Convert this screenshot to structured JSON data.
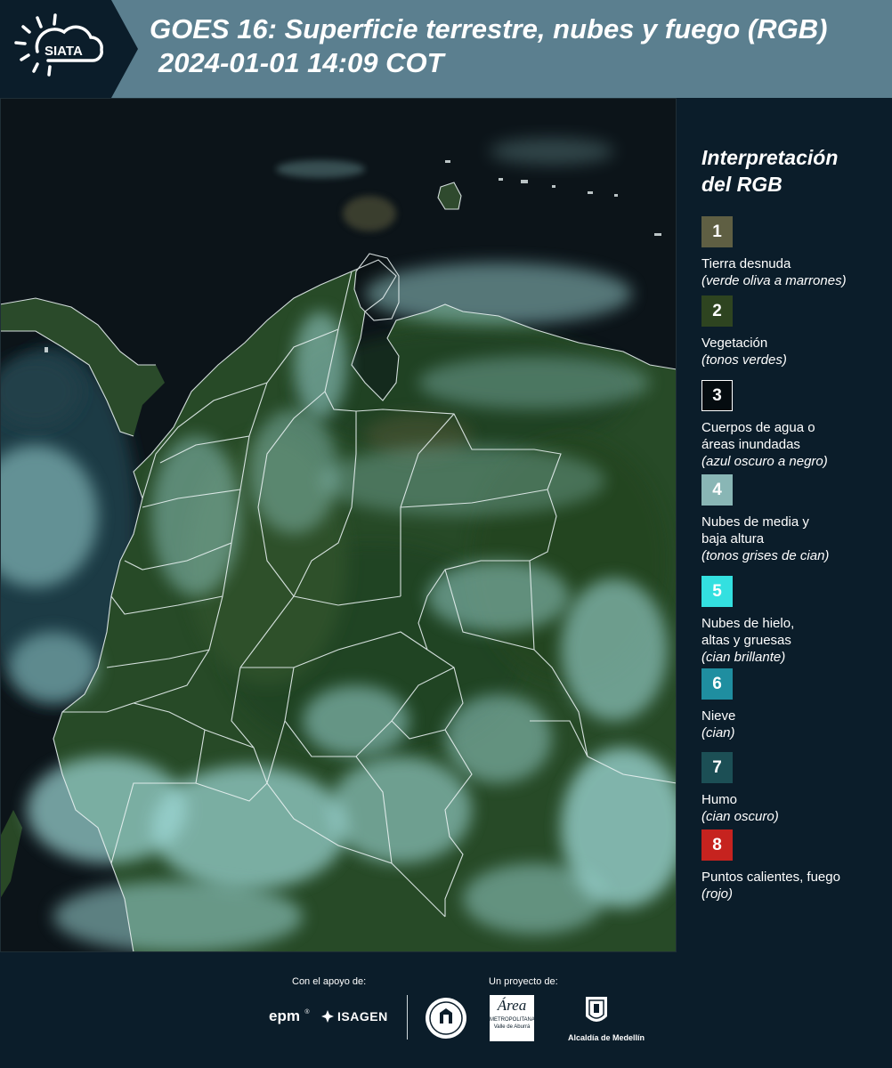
{
  "header": {
    "logo_text": "SIATA",
    "title_line1": "GOES 16: Superficie terrestre, nubes y fuego (RGB)",
    "title_line2": "2024-01-01 14:09 COT"
  },
  "legend": {
    "title_line1": "Interpretación",
    "title_line2": "del RGB",
    "items": [
      {
        "num": "1",
        "color": "#5f5f43",
        "label": [
          "Tierra desnuda"
        ],
        "sub": "(verde oliva a marrones)"
      },
      {
        "num": "2",
        "color": "#2e4420",
        "label": [
          "Vegetación"
        ],
        "sub": "(tonos verdes)"
      },
      {
        "num": "3",
        "color": "#050c10",
        "label": [
          "Cuerpos de agua o",
          "áreas inundadas"
        ],
        "sub": "(azul oscuro a negro)"
      },
      {
        "num": "4",
        "color": "#89b6b5",
        "label": [
          "Nubes de media y",
          "baja altura"
        ],
        "sub": "(tonos grises de cian)"
      },
      {
        "num": "5",
        "color": "#33e0e0",
        "label": [
          "Nubes de hielo,",
          "altas y gruesas"
        ],
        "sub": "(cian brillante)"
      },
      {
        "num": "6",
        "color": "#1f8ea0",
        "label": [
          "Nieve"
        ],
        "sub": "(cian)"
      },
      {
        "num": "7",
        "color": "#1c4f55",
        "label": [
          "Humo"
        ],
        "sub": "(cian oscuro)"
      },
      {
        "num": "8",
        "color": "#c6231f",
        "label": [
          "Puntos calientes, fuego"
        ],
        "sub": "(rojo)"
      }
    ]
  },
  "footer": {
    "support_label": "Con el apoyo de:",
    "project_label": "Un proyecto de:",
    "brand_epm": "epm",
    "brand_isagen": "ISAGEN",
    "brand_metro_line1": "Área",
    "brand_metro_line2": "METROPOLITANA",
    "brand_metro_line3": "Valle de Aburrá",
    "brand_alcaldia": "Alcaldía de Medellín"
  }
}
